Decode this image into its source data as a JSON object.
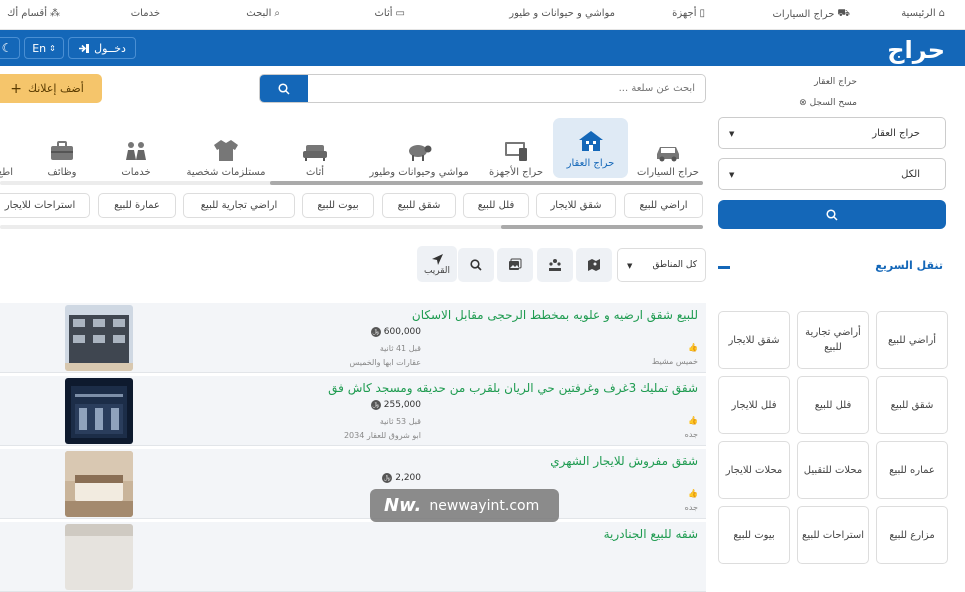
{
  "topnav": [
    {
      "label": "الرئيسية",
      "icon": "home-icon"
    },
    {
      "label": "حراج السيارات",
      "icon": "car-icon"
    },
    {
      "label": "أجهزة",
      "icon": "phone-icon"
    },
    {
      "label": "مواشي و حيوانات و طيور",
      "icon": "animal-icon"
    },
    {
      "label": "أثاث",
      "icon": "sofa-icon"
    },
    {
      "label": "البحث",
      "icon": "search-icon"
    },
    {
      "label": "خدمات",
      "icon": "services-icon"
    },
    {
      "label": "أقسام أك",
      "icon": "grid-icon"
    }
  ],
  "header": {
    "logo": "حراج",
    "login_label": "دخــول",
    "lang_label": "En",
    "theme_icon": "moon-icon",
    "brand_color": "#1467b8"
  },
  "sidebar": {
    "breadcrumb": "حراج العقار",
    "clear_label": "مسح السجل",
    "select_section": "حراج العقار",
    "select_sub": "الكل",
    "quick_title": "تنقل السريع",
    "quick_tiles": [
      "أراضي للبيع",
      "أراضي تجارية للبيع",
      "شقق للايجار",
      "شقق للبيع",
      "فلل للبيع",
      "فلل للايجار",
      "عماره للبيع",
      "محلات للتقبيل",
      "محلات للايجار",
      "مزارع للبيع",
      "استراحات للبيع",
      "بيوت للبيع"
    ]
  },
  "main": {
    "add_label": "أضف إعلانك",
    "search_placeholder": "ابحث عن سلعة ...",
    "categories": [
      {
        "label": "حراج السيارات",
        "icon": "car-icon"
      },
      {
        "label": "حراج العقار",
        "icon": "house-icon",
        "active": true
      },
      {
        "label": "حراج الأجهزة",
        "icon": "devices-icon"
      },
      {
        "label": "مواشي وحيوانات وطيور",
        "icon": "sheep-icon"
      },
      {
        "label": "أثاث",
        "icon": "sofa-icon"
      },
      {
        "label": "مستلزمات شخصية",
        "icon": "shirt-icon"
      },
      {
        "label": "خدمات",
        "icon": "people-icon"
      },
      {
        "label": "وظائف",
        "icon": "briefcase-icon"
      },
      {
        "label": "اطع",
        "icon": "food-icon"
      }
    ],
    "chips": [
      "اراضي للبيع",
      "شقق للايجار",
      "فلل للبيع",
      "شقق للبيع",
      "بيوت للبيع",
      "اراضي تجارية للبيع",
      "عمارة للبيع",
      "استراحات للايجار"
    ],
    "region_label": "كل المناطق",
    "near_label": "القريب",
    "listings": [
      {
        "title": "للبيع شقق ارضيه و علويه بمخطط الرحجى مقابل الاسكان",
        "price": "600,000",
        "time": "قبل 41 ثانية",
        "seller": "عقارات ابها والخميس",
        "city": "خميس مشيط"
      },
      {
        "title": "شقق تمليك 3غرف وغرفتين حي الريان بلقرب من حديقه ومسجد كاش فق",
        "price": "255,000",
        "time": "قبل 53 ثانية",
        "seller": "ابو شروق للعقار 2034",
        "city": "جده"
      },
      {
        "title": "شقق مفروش للايجار الشهري",
        "price": "2,200",
        "time": "",
        "seller": "",
        "city": "جده"
      },
      {
        "title": "شقه للبيع الجنادرية",
        "price": "",
        "time": "",
        "seller": "",
        "city": ""
      }
    ]
  },
  "watermark": {
    "mark": "Nw.",
    "text": "newwayint.com"
  }
}
